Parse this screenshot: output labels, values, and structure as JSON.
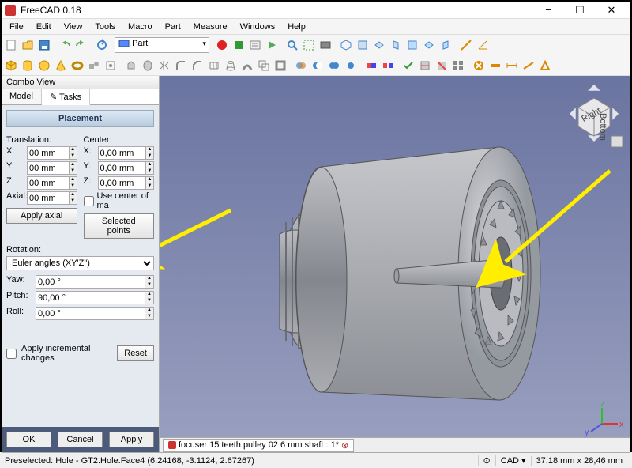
{
  "title": "FreeCAD 0.18",
  "window_buttons": {
    "min": "−",
    "max": "☐",
    "close": "✕"
  },
  "menus": [
    "File",
    "Edit",
    "View",
    "Tools",
    "Macro",
    "Part",
    "Measure",
    "Windows",
    "Help"
  ],
  "workbench": "Part",
  "combo": {
    "title": "Combo View",
    "tabs": [
      "Model",
      "Tasks"
    ],
    "active_tab": 1
  },
  "placement": {
    "header": "Placement",
    "translation_label": "Translation:",
    "center_label": "Center:",
    "x_label": "X:",
    "y_label": "Y:",
    "z_label": "Z:",
    "axial_label": "Axial:",
    "x": "00 mm",
    "y": "00 mm",
    "z": "00 mm",
    "axial": "00 mm",
    "cx": "0,00 mm",
    "cy": "0,00 mm",
    "cz": "0,00 mm",
    "use_center_label": "Use center of ma",
    "apply_axial": "Apply axial",
    "selected_points": "Selected points",
    "rotation_label": "Rotation:",
    "rotation_mode": "Euler angles (XY'Z\")",
    "yaw_label": "Yaw:",
    "pitch_label": "Pitch:",
    "roll_label": "Roll:",
    "yaw": "0,00 °",
    "pitch": "90,00 °",
    "roll": "0,00 °",
    "apply_incremental": "Apply incremental changes",
    "reset": "Reset",
    "ok": "OK",
    "cancel": "Cancel",
    "apply": "Apply"
  },
  "navcube": {
    "right": "Right",
    "bottom": "Bottom"
  },
  "doc_tab": "focuser 15 teeth pulley 02 6 mm shaft : 1*",
  "status": {
    "preselect": "Preselected: Hole - GT2.Hole.Face4 (6.24168, -3.1124, 2.67267)",
    "mode": "CAD",
    "dims": "37,18 mm x 28,46 mm"
  },
  "colors": {
    "accent": "#3a5a8a",
    "panel": "#dce8f5",
    "3dbg": "#6a74a0"
  }
}
